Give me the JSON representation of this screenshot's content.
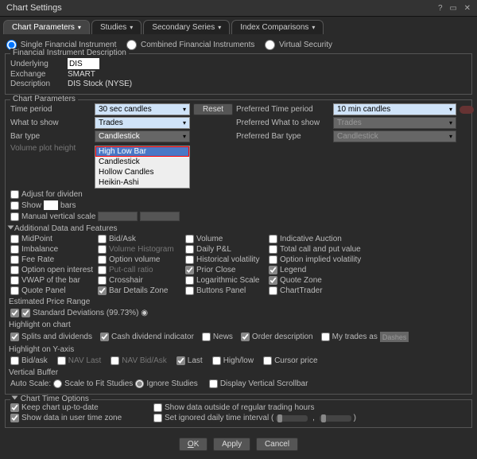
{
  "window": {
    "title": "Chart Settings"
  },
  "tabs": [
    "Chart Parameters",
    "Studies",
    "Secondary Series",
    "Index Comparisons"
  ],
  "mode_options": [
    "Single Financial Instrument",
    "Combined Financial Instruments",
    "Virtual Security"
  ],
  "fin_desc": {
    "title": "Financial Instrument Description",
    "underlying_label": "Underlying",
    "underlying_value": "DIS",
    "exchange_label": "Exchange",
    "exchange_value": "SMART",
    "description_label": "Description",
    "description_value": "DIS Stock (NYSE)"
  },
  "chart_params": {
    "title": "Chart Parameters",
    "time_period_label": "Time period",
    "time_period_value": "30 sec candles",
    "reset": "Reset",
    "what_to_show_label": "What to show",
    "what_to_show_value": "Trades",
    "bar_type_label": "Bar type",
    "bar_type_value": "Candlestick",
    "volume_plot_height_label": "Volume plot height",
    "pref_time_period_label": "Preferred Time period",
    "pref_time_period_value": "10 min candles",
    "pref_what_label": "Preferred What to show",
    "pref_what_value": "Trades",
    "pref_bar_label": "Preferred Bar type",
    "pref_bar_value": "Candlestick"
  },
  "bar_type_options": [
    "High Low Bar",
    "Candlestick",
    "Hollow Candles",
    "Heikin-Ashi"
  ],
  "misc": {
    "adjust_div": "Adjust for dividen",
    "show": "Show",
    "bars": "bars",
    "manual_scale": "Manual vertical scale"
  },
  "addl": {
    "title": "Additional Data and Features",
    "items": [
      [
        "MidPoint",
        "Bid/Ask",
        "Volume",
        "Indicative Auction",
        ""
      ],
      [
        "Imbalance",
        "Volume Histogram",
        "Daily P&L",
        "Total call and put value",
        ""
      ],
      [
        "Fee Rate",
        "Option volume",
        "Historical volatility",
        "Option implied volatility",
        ""
      ],
      [
        "Option open interest",
        "Put-call ratio",
        "Prior Close",
        "Legend",
        ""
      ],
      [
        "VWAP of the bar",
        "Crosshair",
        "Logarithmic Scale",
        "Quote Zone",
        ""
      ],
      [
        "Quote Panel",
        "Bar Details Zone",
        "Buttons Panel",
        "ChartTrader",
        ""
      ]
    ],
    "checked_set": [
      "Prior Close",
      "Legend",
      "Quote Zone",
      "Bar Details Zone"
    ],
    "dim_set": [
      "Volume Histogram",
      "Put-call ratio"
    ]
  },
  "epr": {
    "title": "Estimated Price Range",
    "std_dev": "Standard Deviations (99.73%)"
  },
  "hl_chart": {
    "title": "Highlight on chart",
    "items": [
      "Splits and dividends",
      "Cash dividend indicator",
      "News",
      "Order description",
      "My trades as"
    ],
    "checked": [
      "Splits and dividends",
      "Cash dividend indicator",
      "Order description"
    ],
    "dashes": "Dashes"
  },
  "hl_y": {
    "title": "Highlight on Y-axis",
    "items": [
      "Bid/ask",
      "NAV Last",
      "NAV Bid/Ask",
      "Last",
      "High/low",
      "Cursor price"
    ],
    "checked": [
      "Last"
    ],
    "dim": [
      "NAV Last",
      "NAV Bid/Ask"
    ]
  },
  "vbuf": {
    "title": "Vertical Buffer",
    "auto_scale": "Auto Scale:",
    "options": [
      "Scale to Fit Studies",
      "Ignore Studies"
    ],
    "scrollbar": "Display Vertical Scrollbar"
  },
  "cto": {
    "title": "Chart Time Options",
    "items": [
      "Keep chart up-to-date",
      "Show data outside of regular trading hours",
      "Show data in user time zone",
      "Set ignored daily time interval ("
    ],
    "checked": [
      "Keep chart up-to-date",
      "Show data in user time zone"
    ],
    "close_paren": ")"
  },
  "buttons": {
    "ok": "OK",
    "apply": "Apply",
    "cancel": "Cancel"
  }
}
